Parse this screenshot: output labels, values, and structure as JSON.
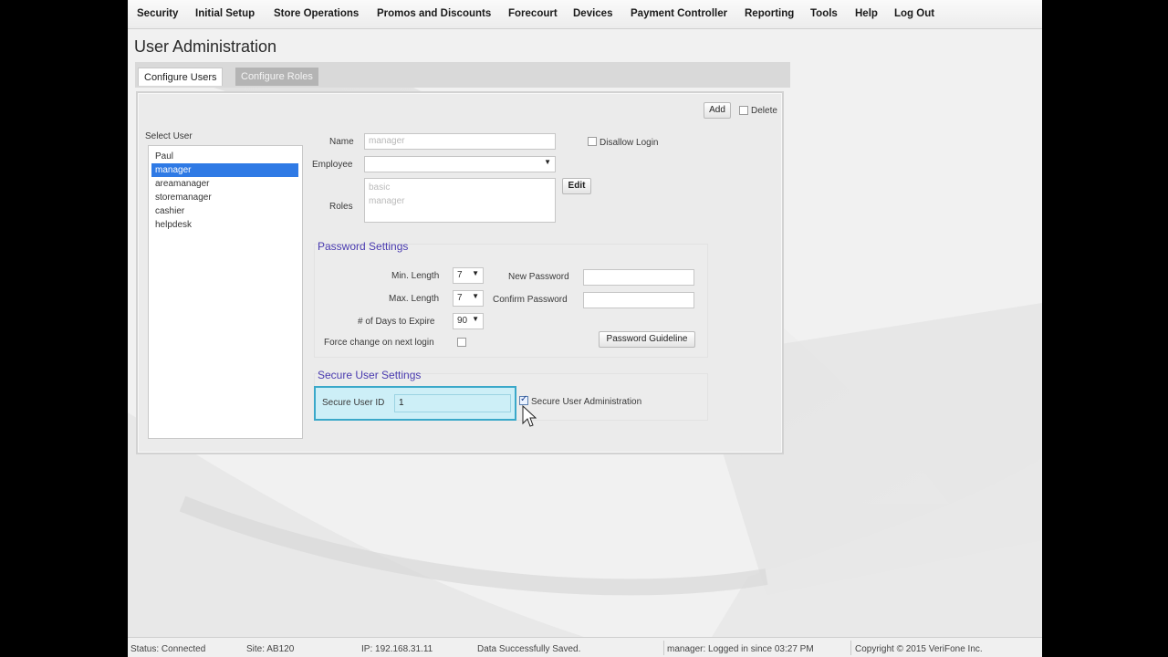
{
  "menu": [
    "Security",
    "Initial Setup",
    "Store Operations",
    "Promos and Discounts",
    "Forecourt",
    "Devices",
    "Payment Controller",
    "Reporting",
    "Tools",
    "Help",
    "Log Out"
  ],
  "page_title": "User Administration",
  "tabs": {
    "configure_users": "Configure Users",
    "configure_roles": "Configure Roles"
  },
  "toolbar": {
    "add_label": "Add",
    "delete_label": "Delete"
  },
  "user_list": {
    "label": "Select User",
    "items": [
      "Paul",
      "manager",
      "areamanager",
      "storemanager",
      "cashier",
      "helpdesk"
    ],
    "selected": "manager"
  },
  "form": {
    "name_label": "Name",
    "name_value": "manager",
    "disallow_login_label": "Disallow Login",
    "employee_label": "Employee",
    "employee_value": "",
    "roles_label": "Roles",
    "roles": [
      "basic",
      "manager"
    ],
    "edit_label": "Edit"
  },
  "password_settings": {
    "title": "Password Settings",
    "min_length_label": "Min. Length",
    "min_length_value": "7",
    "max_length_label": "Max. Length",
    "max_length_value": "7",
    "days_expire_label": "# of Days to Expire",
    "days_expire_value": "90",
    "force_change_label": "Force change on next login",
    "new_password_label": "New Password",
    "confirm_password_label": "Confirm Password",
    "guideline_label": "Password Guideline"
  },
  "secure_settings": {
    "title": "Secure User Settings",
    "secure_id_label": "Secure User ID",
    "secure_id_value": "1",
    "secure_admin_label": "Secure User Administration",
    "secure_admin_checked": true
  },
  "status": {
    "connection": "Status: Connected",
    "site": "Site: AB120",
    "ip": "IP: 192.168.31.11",
    "message": "Data Successfully Saved.",
    "login": "manager: Logged in since 03:27 PM",
    "copyright": "Copyright © 2015 VeriFone Inc."
  }
}
